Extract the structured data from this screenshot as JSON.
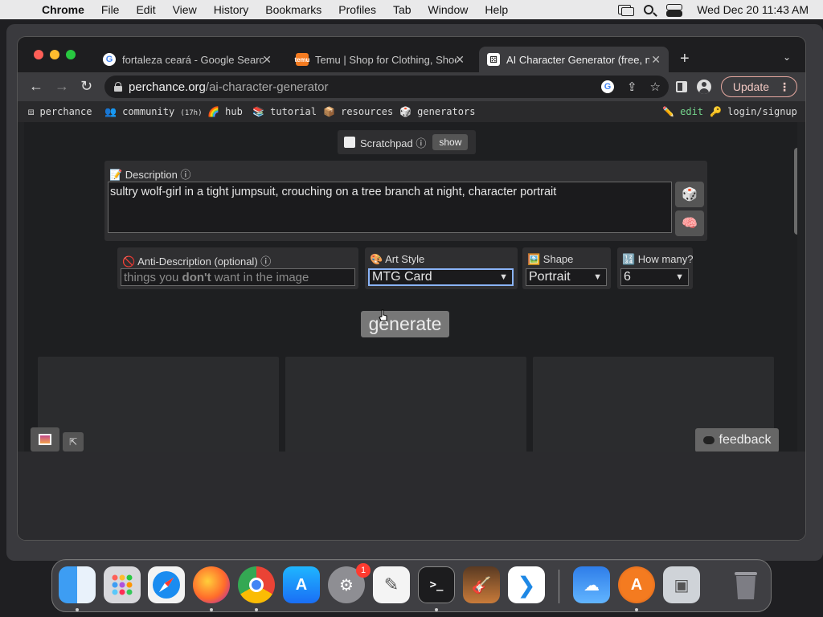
{
  "menubar": {
    "app": "Chrome",
    "items": [
      "File",
      "Edit",
      "View",
      "History",
      "Bookmarks",
      "Profiles",
      "Tab",
      "Window",
      "Help"
    ],
    "clock": "Wed Dec 20  11:43 AM"
  },
  "tabs": [
    {
      "title": "fortaleza ceará - Google Search",
      "favicon": "google-icon"
    },
    {
      "title": "Temu | Shop for Clothing, Shoes",
      "favicon": "temu-icon"
    },
    {
      "title": "AI Character Generator (free, no",
      "favicon": "perchance-icon",
      "active": true
    }
  ],
  "toolbar": {
    "url_host": "perchance.org",
    "url_path": "/ai-character-generator",
    "update_label": "Update"
  },
  "site_nav": {
    "perchance": "⚄ perchance",
    "community": "👥 community",
    "community_count": "(17h)",
    "hub": "🌈 hub",
    "tutorial": "📚 tutorial",
    "resources": "📦 resources",
    "generators": "🎲 generators",
    "edit": "✏️ edit",
    "login": "🔑 login/signup"
  },
  "scratchpad": {
    "label": "Scratchpad ⓘ",
    "show": "show"
  },
  "description": {
    "label": "📝 Description ⓘ",
    "value": "sultry wolf-girl in a tight jumpsuit, crouching on a tree branch at night, character portrait"
  },
  "anti_description": {
    "label": "🚫 Anti-Description (optional) ⓘ",
    "placeholder_a": "things you ",
    "placeholder_b": "don't",
    "placeholder_c": " want in the image"
  },
  "art_style": {
    "label": "🎨 Art Style",
    "value": "MTG Card"
  },
  "shape": {
    "label": "🖼️ Shape",
    "value": "Portrait"
  },
  "how_many": {
    "label": "🔢 How many?",
    "value": "6"
  },
  "generate_label": "generate",
  "feedback_label": "feedback",
  "dock": {
    "apps": [
      "Finder",
      "Launchpad",
      "Safari",
      "Firefox",
      "Chrome",
      "App Store",
      "System Settings",
      "TextEdit",
      "Terminal",
      "GarageBand",
      "VS Code",
      "Weather",
      "Alfred",
      "Preview",
      "Trash"
    ],
    "badge": "1"
  },
  "colors": {
    "accent_focus": "#8ab4f8",
    "edit_link": "#74d48c",
    "update_border": "#e6a8a0"
  }
}
